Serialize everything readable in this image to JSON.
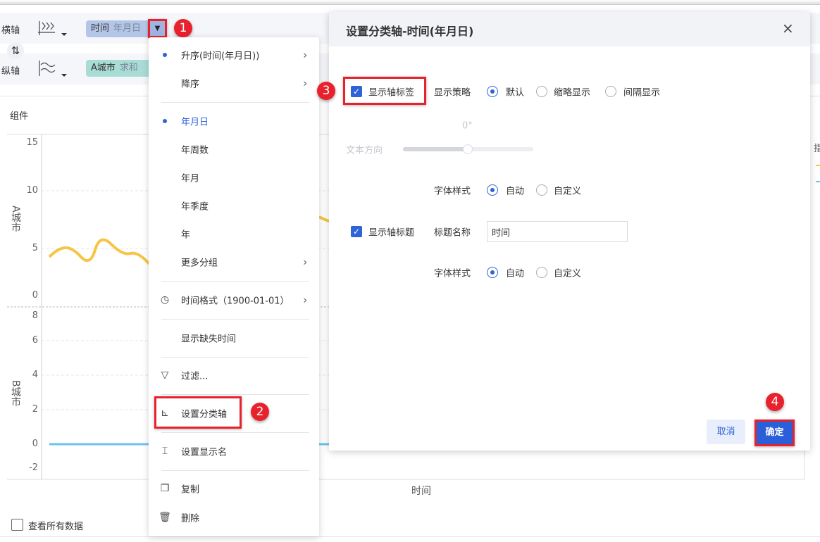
{
  "toolbar": {
    "x_axis_label": "横轴",
    "y_axis_label": "纵轴",
    "x_field": {
      "name": "时间",
      "sub": "年月日",
      "color": "#b4c6e8"
    },
    "y_field": {
      "name": "A城市",
      "sub": "求和",
      "color": "#a9dcd5"
    },
    "swap_icon": "swap-vertical-icon"
  },
  "component_label": "组件",
  "chart": {
    "upper_axis_title": "A城市",
    "lower_axis_title": "B城市",
    "upper_ticks": [
      "15",
      "10",
      "5",
      "0"
    ],
    "lower_ticks": [
      "8",
      "6",
      "4",
      "2",
      "0",
      "-2"
    ],
    "x_axis_title": "时间",
    "legend_partial": "指",
    "series_colors": [
      "#f7c543",
      "#6cc3ef"
    ]
  },
  "view_all_label": "查看所有数据",
  "menu": {
    "items": [
      {
        "label": "升序(时间(年月日))",
        "bullet": true,
        "chevron": true
      },
      {
        "label": "降序",
        "chevron": true
      },
      {
        "label": "年月日",
        "bullet": true,
        "active": true
      },
      {
        "label": "年周数"
      },
      {
        "label": "年月"
      },
      {
        "label": "年季度"
      },
      {
        "label": "年"
      },
      {
        "label": "更多分组",
        "chevron": true
      },
      {
        "label": "时间格式（1900-01-01）",
        "icon": "clock-icon",
        "chevron": true
      },
      {
        "label": "显示缺失时间"
      },
      {
        "label": "过滤...",
        "icon": "filter-icon"
      },
      {
        "label": "设置分类轴",
        "icon": "category-axis-icon"
      },
      {
        "label": "设置显示名",
        "icon": "rename-icon"
      },
      {
        "label": "复制",
        "icon": "copy-icon"
      },
      {
        "label": "删除",
        "icon": "trash-icon"
      }
    ]
  },
  "dialog": {
    "title": "设置分类轴-时间(年月日)",
    "show_axis_label": {
      "label": "显示轴标签",
      "checked": true
    },
    "display_strategy": {
      "label": "显示策略",
      "options": [
        "默认",
        "缩略显示",
        "间隔显示"
      ],
      "selected": "默认"
    },
    "text_direction": {
      "label": "文本方向",
      "value": "0°",
      "fraction": 0.5
    },
    "label_font_style": {
      "label": "字体样式",
      "options": [
        "自动",
        "自定义"
      ],
      "selected": "自动"
    },
    "show_axis_title": {
      "label": "显示轴标题",
      "checked": true
    },
    "title_name": {
      "label": "标题名称",
      "value": "时间"
    },
    "title_font_style": {
      "label": "字体样式",
      "options": [
        "自动",
        "自定义"
      ],
      "selected": "自动"
    },
    "cancel": "取消",
    "confirm": "确定"
  },
  "badges": [
    "1",
    "2",
    "3",
    "4"
  ],
  "accent": "#2f64d8",
  "highlight": "#e8222c"
}
